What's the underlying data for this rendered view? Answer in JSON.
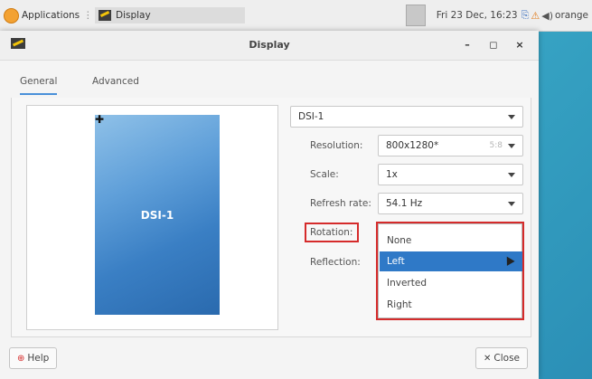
{
  "panel": {
    "applications_label": "Applications",
    "task_label": "Display",
    "clock": "Fri 23 Dec, 16:23",
    "user": "orange"
  },
  "window": {
    "title": "Display",
    "controls": {
      "minimize": "–",
      "maximize": "◻",
      "close": "×"
    }
  },
  "tabs": [
    {
      "label": "General",
      "active": true
    },
    {
      "label": "Advanced",
      "active": false
    }
  ],
  "preview": {
    "monitor_label": "DSI-1"
  },
  "output_select": "DSI-1",
  "fields": {
    "resolution": {
      "label": "Resolution:",
      "value": "800x1280*",
      "aspect": "5:8"
    },
    "scale": {
      "label": "Scale:",
      "value": "1x"
    },
    "refresh": {
      "label": "Refresh rate:",
      "value": "54.1 Hz"
    },
    "rotation": {
      "label": "Rotation:"
    },
    "reflection": {
      "label": "Reflection:"
    }
  },
  "rotation_options": [
    {
      "label": "None",
      "selected": false
    },
    {
      "label": "Left",
      "selected": true
    },
    {
      "label": "Inverted",
      "selected": false
    },
    {
      "label": "Right",
      "selected": false
    }
  ],
  "buttons": {
    "help": "Help",
    "close": "Close"
  },
  "colors": {
    "accent": "#2f79c7",
    "highlight": "#d52b2b"
  }
}
